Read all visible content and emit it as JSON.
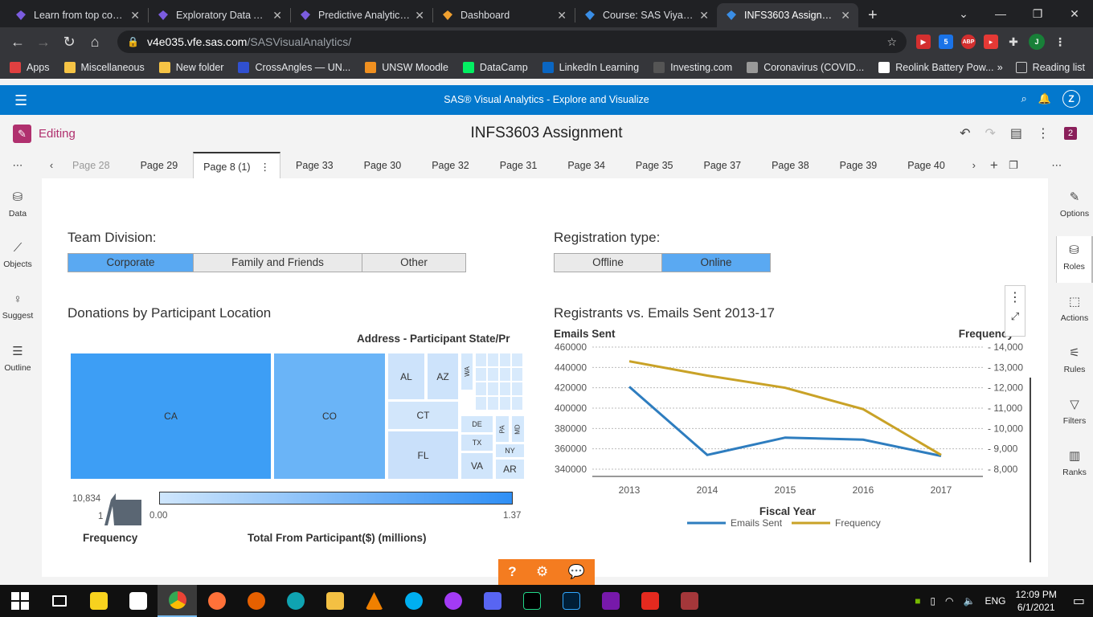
{
  "browser": {
    "tabs": [
      {
        "title": "Learn from top comp",
        "active": false,
        "color": "#7b5ce0"
      },
      {
        "title": "Exploratory Data Ana",
        "active": false,
        "color": "#7b5ce0"
      },
      {
        "title": "Predictive Analytics A",
        "active": false,
        "color": "#7b5ce0"
      },
      {
        "title": "Dashboard",
        "active": false,
        "color": "#f0a030"
      },
      {
        "title": "Course: SAS Viya for",
        "active": false,
        "color": "#3a8ee6"
      },
      {
        "title": "INFS3603 Assignmen",
        "active": true,
        "color": "#3a8ee6"
      }
    ],
    "url_host": "v4e035.vfe.sas.com",
    "url_path": "/SASVisualAnalytics/",
    "profile_initial": "J",
    "extension_badge": "5",
    "abp_label": "ABP",
    "bookmarks": [
      {
        "label": "Apps",
        "color": "#e04040"
      },
      {
        "label": "Miscellaneous",
        "color": "#f6c445"
      },
      {
        "label": "New folder",
        "color": "#f6c445"
      },
      {
        "label": "CrossAngles — UN...",
        "color": "#3050d0"
      },
      {
        "label": "UNSW Moodle",
        "color": "#f09020"
      },
      {
        "label": "DataCamp",
        "color": "#03ef62"
      },
      {
        "label": "LinkedIn Learning",
        "color": "#0a66c2"
      },
      {
        "label": "Investing.com",
        "color": "#555555"
      },
      {
        "label": "Coronavirus (COVID...",
        "color": "#999999"
      },
      {
        "label": "Reolink Battery Pow...",
        "color": "#ffffff"
      }
    ],
    "reading_list": "Reading list"
  },
  "sas": {
    "app_title": "SAS® Visual Analytics - Explore and Visualize",
    "user_initial": "Z",
    "editing_label": "Editing",
    "report_title": "INFS3603 Assignment",
    "notif_count": "2",
    "page_tabs": [
      "Page 28",
      "Page 29",
      "Page 8 (1)",
      "Page 33",
      "Page 30",
      "Page 32",
      "Page 31",
      "Page 34",
      "Page 35",
      "Page 37",
      "Page 38",
      "Page 39",
      "Page 40"
    ],
    "active_page_index": 2,
    "left_nav": [
      {
        "label": "Data",
        "icon": "database-icon"
      },
      {
        "label": "Objects",
        "icon": "chart-line-icon"
      },
      {
        "label": "Suggest",
        "icon": "lightbulb-icon"
      },
      {
        "label": "Outline",
        "icon": "list-icon"
      }
    ],
    "right_nav": [
      {
        "label": "Options",
        "icon": "palette-icon"
      },
      {
        "label": "Roles",
        "icon": "roles-icon"
      },
      {
        "label": "Actions",
        "icon": "cursor-icon"
      },
      {
        "label": "Rules",
        "icon": "rules-icon"
      },
      {
        "label": "Filters",
        "icon": "filter-icon"
      },
      {
        "label": "Ranks",
        "icon": "ranks-icon"
      }
    ]
  },
  "controls": {
    "team_division": {
      "label": "Team Division:",
      "options": [
        "Corporate",
        "Family and Friends",
        "Other"
      ],
      "selected": 0
    },
    "registration_type": {
      "label": "Registration type:",
      "options": [
        "Offline",
        "Online"
      ],
      "selected": 1
    }
  },
  "treemap": {
    "title": "Donations by Participant Location",
    "hierarchy_label": "Address  -  Participant State/Pr",
    "tiles": [
      "CA",
      "CO",
      "AL",
      "AZ",
      "WA",
      "CT",
      "DE",
      "PA",
      "MD",
      "TX",
      "NY",
      "FL",
      "VA",
      "AR"
    ],
    "size_legend": {
      "max": "10,834",
      "min": "1",
      "title": "Frequency"
    },
    "color_legend": {
      "min": "0.00",
      "max": "1.37",
      "title": "Total From Participant($) (millions)"
    }
  },
  "chart_data": {
    "type": "line",
    "title": "Registrants vs. Emails Sent 2013-17",
    "xlabel": "Fiscal Year",
    "ylabel": "Emails Sent",
    "y2label": "Frequency",
    "categories": [
      "2013",
      "2014",
      "2015",
      "2016",
      "2017"
    ],
    "ylim": [
      340000,
      460000
    ],
    "y_ticks": [
      "460000",
      "440000",
      "420000",
      "400000",
      "380000",
      "360000",
      "340000"
    ],
    "y2lim": [
      8000,
      14000
    ],
    "y2_ticks": [
      "14,000",
      "13,000",
      "12,000",
      "11,000",
      "10,000",
      "9,000",
      "8,000"
    ],
    "series": [
      {
        "name": "Emails Sent",
        "axis": "left",
        "color": "#2e7dbf",
        "values": [
          421000,
          354000,
          371000,
          369000,
          353000
        ]
      },
      {
        "name": "Frequency",
        "axis": "right",
        "color": "#c9a227",
        "values": [
          13300,
          12600,
          12000,
          10950,
          8700
        ]
      }
    ],
    "grid": true,
    "legend": "bottom"
  },
  "taskbar": {
    "lang": "ENG",
    "time": "12:09 PM",
    "date": "6/1/2021"
  }
}
